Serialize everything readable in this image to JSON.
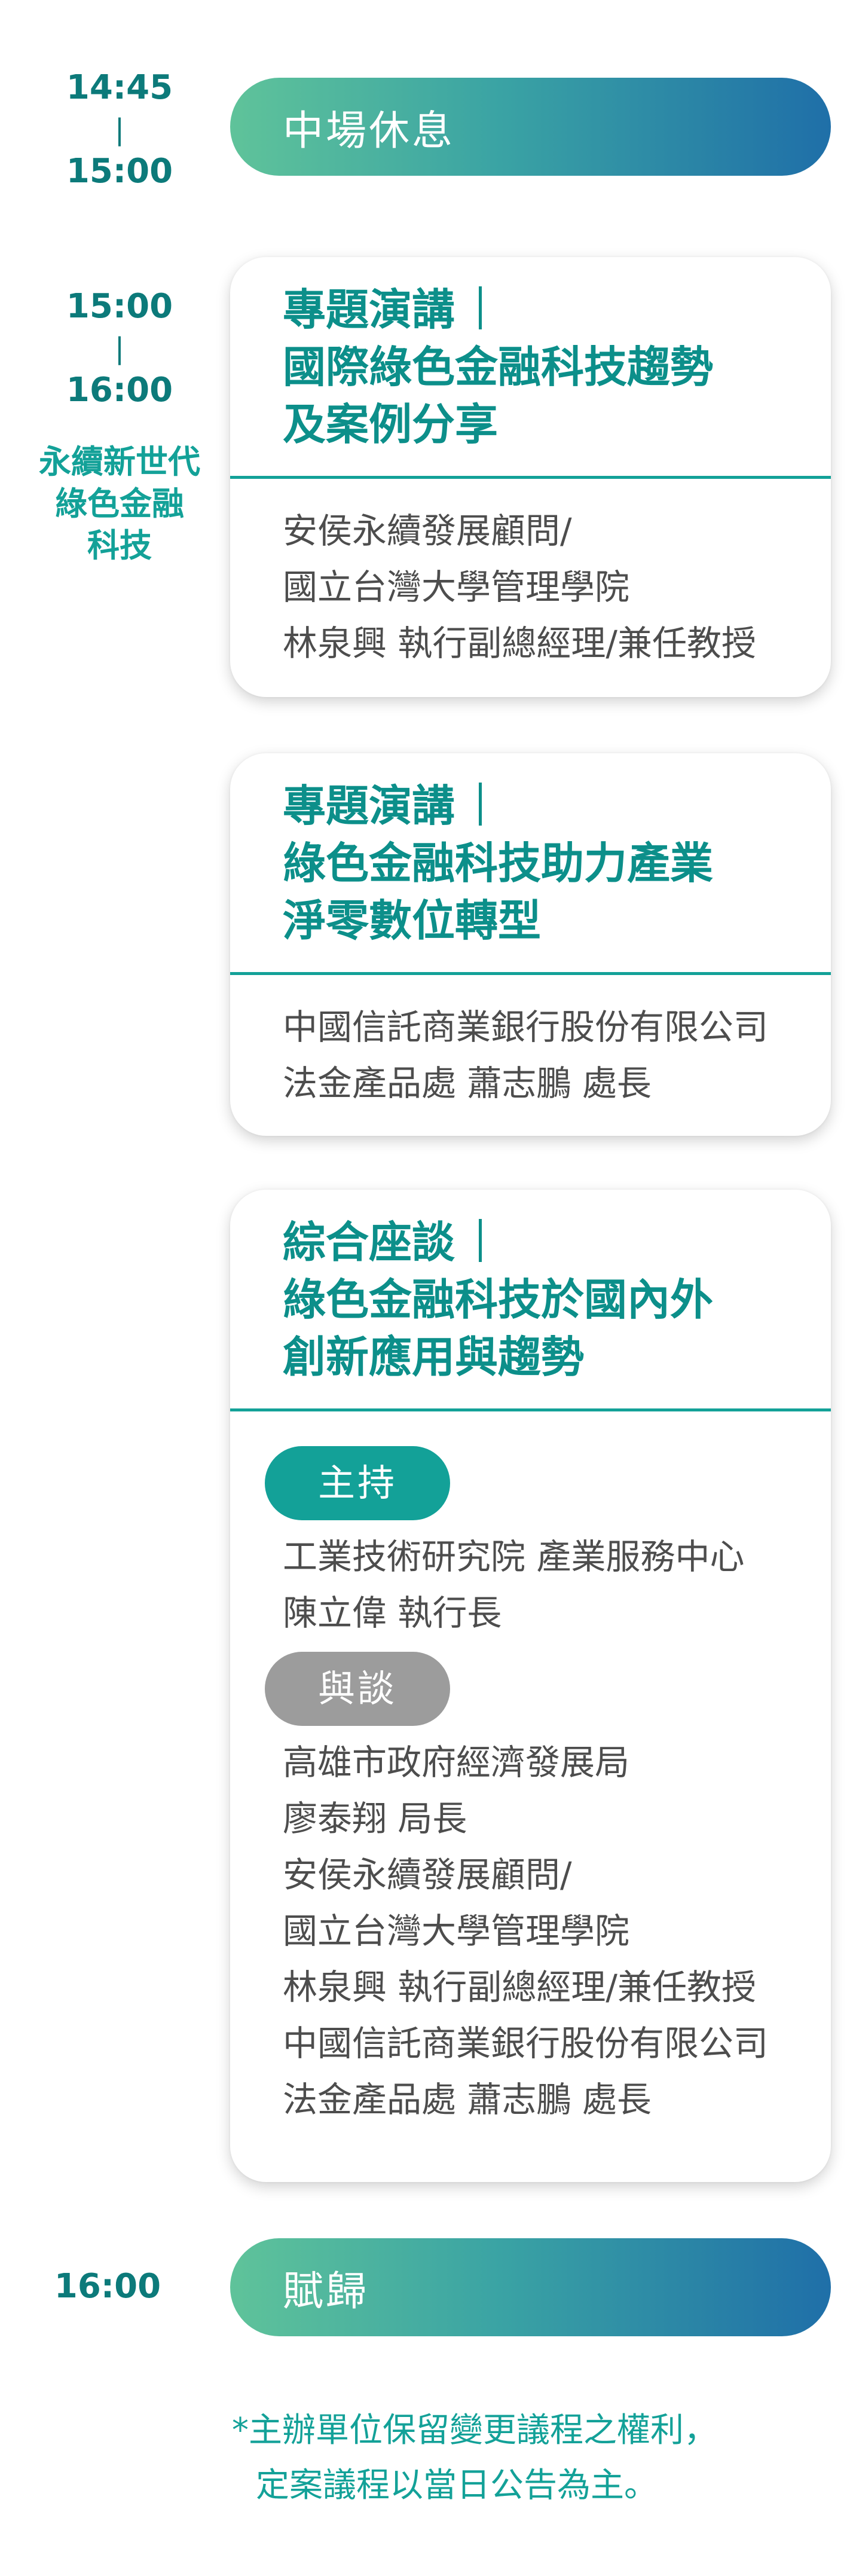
{
  "break": {
    "time_start": "14:45",
    "time_sep": "|",
    "time_end": "15:00",
    "label": "中場休息"
  },
  "session": {
    "time_start": "15:00",
    "time_sep": "|",
    "time_end": "16:00",
    "label_lines": [
      "永續新世代",
      "綠色金融",
      "科技"
    ]
  },
  "cards": [
    {
      "title_lines": [
        "專題演講",
        "國際綠色金融科技趨勢",
        "及案例分享"
      ],
      "speaker_lines": [
        "安侯永續發展顧問/",
        "國立台灣大學管理學院",
        "林泉興 執行副總經理/兼任教授"
      ]
    },
    {
      "title_lines": [
        "專題演講",
        "綠色金融科技助力產業",
        "淨零數位轉型"
      ],
      "speaker_lines": [
        "中國信託商業銀行股份有限公司",
        "法金產品處 蕭志鵬 處長"
      ]
    },
    {
      "title_lines": [
        "綜合座談",
        "綠色金融科技於國內外",
        "創新應用與趨勢"
      ],
      "host_label": "主持",
      "host_lines": [
        "工業技術研究院 產業服務中心",
        "陳立偉 執行長"
      ],
      "panel_label": "與談",
      "panel_lines": [
        "高雄市政府經濟發展局",
        "廖泰翔 局長",
        "安侯永續發展顧問/",
        "國立台灣大學管理學院",
        "林泉興 執行副總經理/兼任教授",
        "中國信託商業銀行股份有限公司",
        "法金產品處 蕭志鵬 處長"
      ]
    }
  ],
  "closing": {
    "time": "16:00",
    "label": "賦歸"
  },
  "note": {
    "lines": [
      "*主辦單位保留變更議程之權利，",
      "定案議程以當日公告為主。"
    ]
  },
  "colors": {
    "teal": "#13a198",
    "dark_teal": "#0c7a7a",
    "gradient_start": "#5fc39a",
    "gradient_end": "#1f6fa8",
    "panel_gray": "#9c9c9c"
  }
}
